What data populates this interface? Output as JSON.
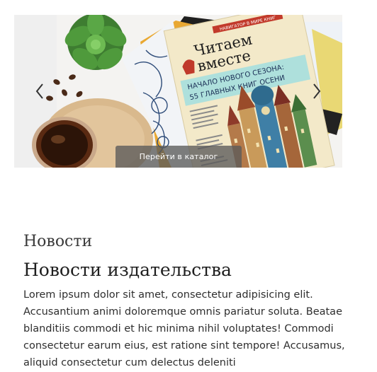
{
  "carousel": {
    "magazine_header": "НАВИГАТОР В МИРЕ КНИГ",
    "magazine_title_1": "Читаем",
    "magazine_title_2": "вместе",
    "magazine_subtitle_1": "НАЧАЛО НОВОГО СЕЗОНА:",
    "magazine_subtitle_2": "55 ГЛАВНЫХ КНИГ ОСЕНИ",
    "catalog_button": "Перейти в каталог"
  },
  "news": {
    "section_title": "Новости",
    "heading": "Новости издательства",
    "body": "Lorem ipsum dolor sit amet, consectetur adipisicing elit. Accusantium animi doloremque omnis pariatur soluta. Beatae blanditiis commodi et hic minima nihil voluptates! Commodi consectetur earum eius, est ratione sint tempore! Accusamus, aliquid consectetur cum delectus deleniti"
  },
  "colors": {
    "button_bg": "#5a5a5a",
    "magazine_cover": "#f1e7c6",
    "accent_red": "#c0392b"
  }
}
